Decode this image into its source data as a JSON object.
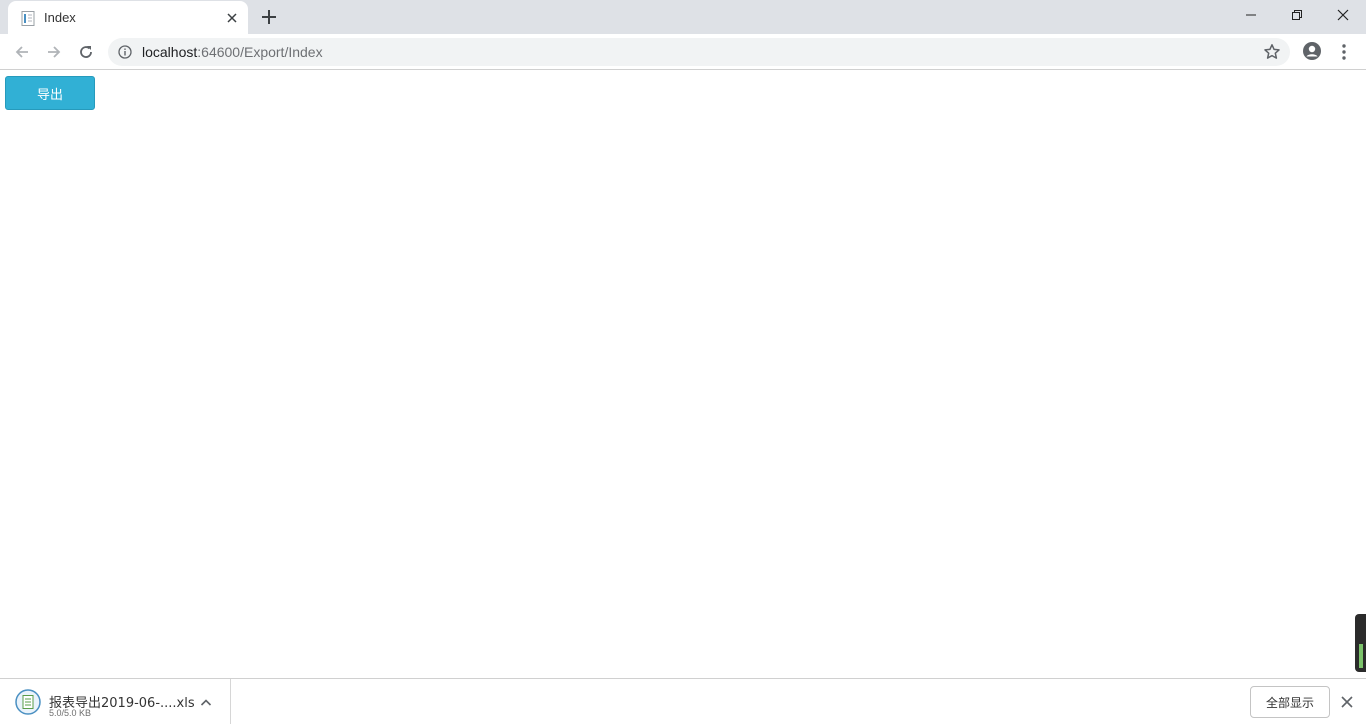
{
  "browser": {
    "tab": {
      "title": "Index",
      "favicon": "document-icon"
    },
    "url": {
      "host": "localhost",
      "rest": ":64600/Export/Index"
    },
    "icons": {
      "back": "arrow-left-icon",
      "forward": "arrow-right-icon",
      "reload": "reload-icon",
      "info": "info-icon",
      "bookmark": "star-icon",
      "profile": "account-icon",
      "menu": "kebab-menu-icon",
      "new_tab": "plus-icon",
      "minimize": "minimize-icon",
      "restore": "restore-icon",
      "close": "close-icon"
    }
  },
  "page": {
    "export_button": "导出",
    "button_color": "#31b0d5"
  },
  "downloads": {
    "file_name": "报表导出2019-06-....xls",
    "status": "5.0/5.0 KB",
    "show_all": "全部显示"
  }
}
